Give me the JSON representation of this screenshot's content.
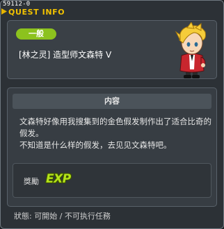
{
  "quest_id": "59112-0",
  "window_title": "QUEST INFO",
  "category_badge": "一般",
  "quest_name": "[林之灵] 造型师文森特 V",
  "character_icon": "npc-portrait-icon",
  "content": {
    "header": "内容",
    "lines": [
      "文森特好像用我搜集到的金色假发制作出了适合比奇的假发。",
      "不知道是什么样的假发，去见见文森特吧。"
    ]
  },
  "reward": {
    "label": "獎勵",
    "exp_label": "EXP"
  },
  "status": "狀態: 可開始 / 不可执行任務",
  "colors": {
    "title": "#f2c200",
    "badge": "#8cc21e",
    "exp": "#b3e21a"
  }
}
